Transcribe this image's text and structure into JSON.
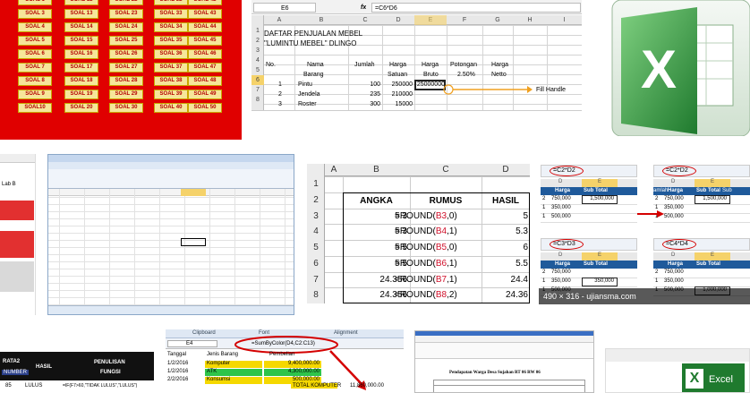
{
  "soal_grid": {
    "columns": [
      [
        "SOAL 1",
        "SOAL 3",
        "SOAL 4",
        "SOAL 5",
        "SOAL 6",
        "SOAL 7",
        "SOAL 8",
        "SOAL 9",
        "SOAL10"
      ],
      [
        "SOAL 12",
        "SOAL 13",
        "SOAL 14",
        "SOAL 15",
        "SOAL 16",
        "SOAL 17",
        "SOAL 18",
        "SOAL 19",
        "SOAL 20"
      ],
      [
        "SOAL 22",
        "SOAL 23",
        "SOAL 24",
        "SOAL 25",
        "SOAL 26",
        "SOAL 27",
        "SOAL 28",
        "SOAL 29",
        "SOAL 30"
      ],
      [
        "SOAL 32",
        "SOAL 33",
        "SOAL 34",
        "SOAL 35",
        "SOAL 36",
        "SOAL 37",
        "SOAL 38",
        "SOAL 39",
        "SOAL 40"
      ],
      [
        "SOAL 42",
        "SOAL 43",
        "SOAL 44",
        "SOAL 45",
        "SOAL 46",
        "SOAL 47",
        "SOAL 48",
        "SOAL 49",
        "SOAL 50"
      ]
    ],
    "top_row": [
      "SOAL 1",
      "SOAL 12",
      "SOAL 22",
      "SOAL 32",
      "SOAL 42"
    ]
  },
  "mebel": {
    "name_box": "E6",
    "fx": "fx",
    "formula": "=C6*D6",
    "col_headers": [
      "A",
      "B",
      "C",
      "D",
      "E",
      "F",
      "G",
      "H",
      "I"
    ],
    "row_numbers": [
      "1",
      "2",
      "3",
      "4",
      "5",
      "6",
      "7",
      "8"
    ],
    "title1": "DAFTAR PENJUALAN MEBEL",
    "title2": "\"LUMINTU MEBEL\" DLINGO",
    "headers": {
      "no": "No.",
      "nama": "Nama",
      "barang": "Barang",
      "jumlah": "Jumlah",
      "harga": "Harga",
      "satuan": "Satuan",
      "harga2": "Harga",
      "bruto": "Bruto",
      "potongan": "Potongan",
      "pct": "2.50%",
      "harga3": "Harga",
      "netto": "Netto"
    },
    "rows": [
      {
        "no": "1",
        "nama": "Pintu",
        "jumlah": "100",
        "satuan": "250000",
        "bruto": "25000000"
      },
      {
        "no": "2",
        "nama": "Jendela",
        "jumlah": "235",
        "satuan": "210000",
        "bruto": ""
      },
      {
        "no": "3",
        "nama": "Roster",
        "jumlah": "300",
        "satuan": "15000",
        "bruto": ""
      }
    ],
    "fill_handle": "Fill Handle"
  },
  "round": {
    "col_headers": [
      "A",
      "B",
      "C",
      "D"
    ],
    "row_numbers": [
      "1",
      "2",
      "3",
      "4",
      "5",
      "6",
      "7",
      "8"
    ],
    "headers": [
      "ANGKA",
      "RUMUS",
      "HASIL"
    ],
    "rows": [
      {
        "angka": "5.3",
        "f_pre": "=ROUND(",
        "ref": "B3",
        "f_post": ",0)",
        "hasil": "5"
      },
      {
        "angka": "5.3",
        "f_pre": "=ROUND(",
        "ref": "B4",
        "f_post": ",1)",
        "hasil": "5.3"
      },
      {
        "angka": "5.5",
        "f_pre": "=ROUND(",
        "ref": "B5",
        "f_post": ",0)",
        "hasil": "6"
      },
      {
        "angka": "5.5",
        "f_pre": "=ROUND(",
        "ref": "B6",
        "f_post": ",1)",
        "hasil": "5.5"
      },
      {
        "angka": "24.356",
        "f_pre": "=ROUND(",
        "ref": "B7",
        "f_post": ",1)",
        "hasil": "24.4"
      },
      {
        "angka": "24.356",
        "f_pre": "=ROUND(",
        "ref": "B8",
        "f_post": ",2)",
        "hasil": "24.36"
      }
    ]
  },
  "subtotal": {
    "f1": "=C2*D2",
    "f2": "=C2*D2",
    "f3": "=C3*D3",
    "f4": "=C4*D4",
    "col_d": "D",
    "col_e": "E",
    "harga": "Harga",
    "subtotal": "Sub Total",
    "sub": "Sub",
    "amlah": "amlah",
    "vals": [
      "750,000",
      "350,000",
      "500,000"
    ],
    "r1": "1,500,000",
    "r2": "350,000",
    "r3": "1,000,000",
    "nums": [
      "2",
      "1",
      "1"
    ],
    "caption": "490 × 316 - ujiansma.com"
  },
  "bottom_left": {
    "rata2": "RATA2",
    "hasil": "HASIL",
    "penulisan": "PENULISAN",
    "fungsi": "FUNGSI",
    "number": "NUMBER",
    "v1": "85",
    "v2": "LULUS",
    "v3": "=IF(F7>60,\"TIDAK LULUS\",\"LULUS\")"
  },
  "sumcolor": {
    "clipboard": "Clipboard",
    "font": "Font",
    "alignment": "Alignment",
    "name_box": "E4",
    "formula": "=SumByColor(D4,C2:C13)",
    "headers": [
      "Tanggal",
      "Jenis Barang",
      "Pembelian"
    ],
    "rows": [
      {
        "date": "1/2/2016",
        "item": "Komputer",
        "amount": "9,400,000.00"
      },
      {
        "date": "1/2/2016",
        "item": "ATK",
        "amount": "4,300,000.00"
      },
      {
        "date": "2/2/2016",
        "item": "Konsumsi",
        "amount": "500,000.00"
      }
    ],
    "total_label": "TOTAL KOMPUTER",
    "total": "11,860,000.00"
  },
  "doc": {
    "title": "Pendapatan Warga Desa Sujahan RT 06 RW 06"
  },
  "left_strip": {
    "lab": "Lab B"
  },
  "excel_logo": {
    "letter": "X",
    "label": "Excel"
  },
  "colors": {
    "soal_red": "#e00000",
    "excel_green": "#1f7a2e",
    "highlight_red": "#d40000"
  }
}
